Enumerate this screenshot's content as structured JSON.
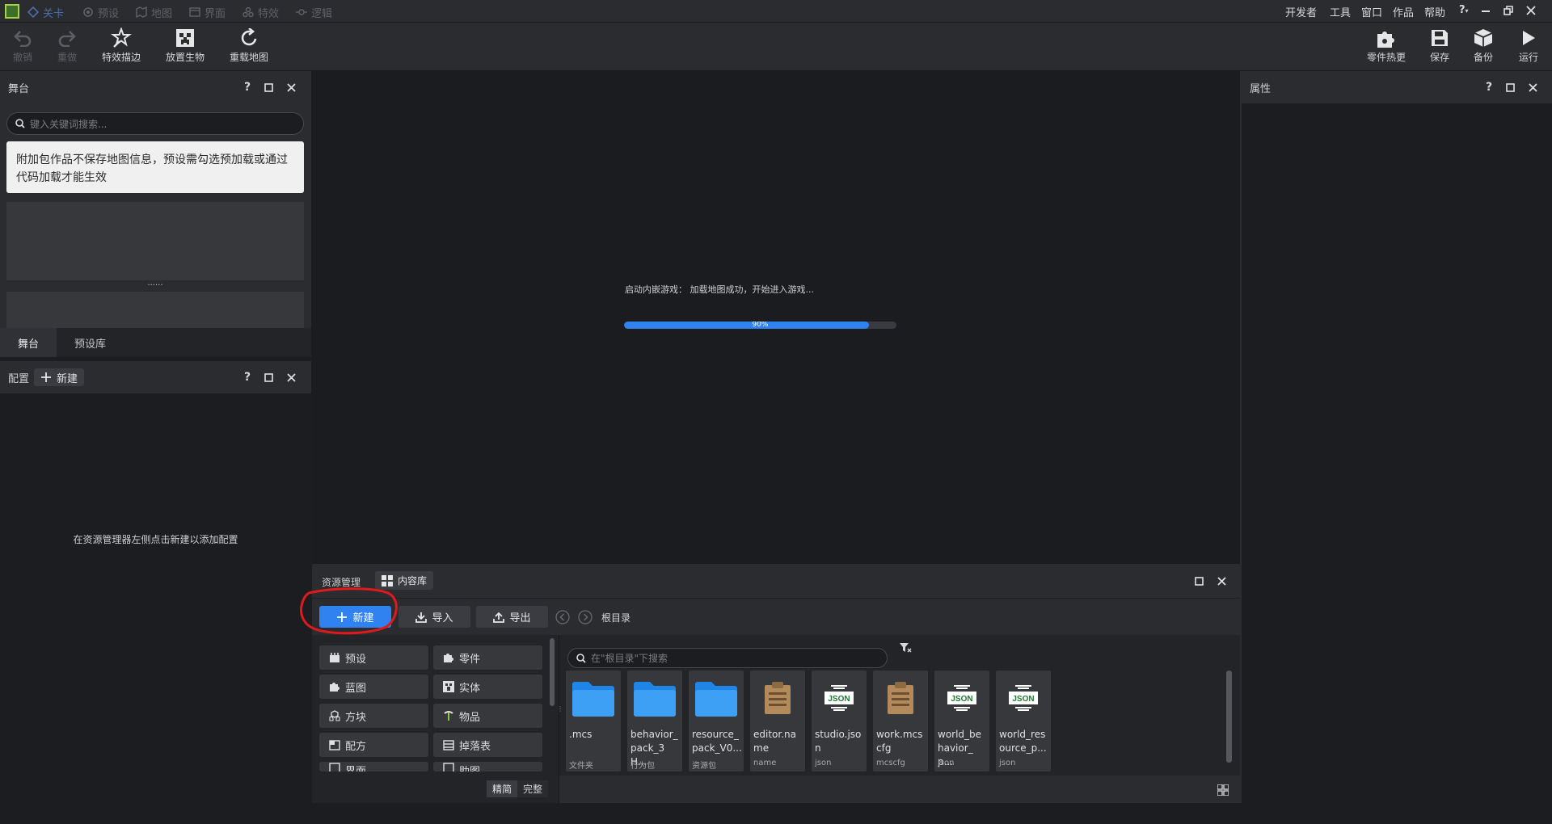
{
  "menubar": {
    "tabs": [
      {
        "label": "关卡"
      },
      {
        "label": "预设"
      },
      {
        "label": "地图"
      },
      {
        "label": "界面"
      },
      {
        "label": "特效"
      },
      {
        "label": "逻辑"
      }
    ],
    "right_menu": [
      "开发者",
      "工具",
      "窗口",
      "作品",
      "帮助",
      "?"
    ]
  },
  "toolbar": {
    "left": [
      {
        "label": "撤销"
      },
      {
        "label": "重做"
      },
      {
        "label": "特效描边"
      },
      {
        "label": "放置生物"
      },
      {
        "label": "重载地图"
      }
    ],
    "right": [
      {
        "label": "零件热更"
      },
      {
        "label": "保存"
      },
      {
        "label": "备份"
      },
      {
        "label": "运行"
      }
    ]
  },
  "stage_panel": {
    "title": "舞台",
    "search_placeholder": "键入关键词搜索...",
    "notice": "附加包作品不保存地图信息，预设需勾选预加载或通过代码加载才能生效",
    "splitter": "......",
    "tabs": [
      {
        "label": "舞台"
      },
      {
        "label": "预设库"
      }
    ]
  },
  "config_panel": {
    "title": "配置",
    "new_label": "新建",
    "empty_text": "在资源管理器左侧点击新建以添加配置"
  },
  "viewport": {
    "loading_text": "启动内嵌游戏：  加载地图成功，开始进入游戏...",
    "progress": {
      "value": 90,
      "label": "90%"
    }
  },
  "properties_panel": {
    "title": "属性"
  },
  "assets_panel": {
    "tabs": [
      {
        "label": "资源管理"
      },
      {
        "label": "内容库"
      }
    ],
    "buttons": {
      "new": "新建",
      "import": "导入",
      "export": "导出"
    },
    "breadcrumb": "根目录",
    "search_placeholder": "在\"根目录\"下搜索",
    "categories": [
      {
        "label": "预设"
      },
      {
        "label": "零件"
      },
      {
        "label": "蓝图"
      },
      {
        "label": "实体"
      },
      {
        "label": "方块"
      },
      {
        "label": "物品"
      },
      {
        "label": "配方"
      },
      {
        "label": "掉落表"
      },
      {
        "label": "界面"
      },
      {
        "label": "助图"
      }
    ],
    "view_modes": [
      "精简",
      "完整"
    ],
    "files": [
      {
        "name": ".mcs",
        "type": "文件夹",
        "icon": "folder"
      },
      {
        "name": "behavior_ pack_3H...",
        "type": "行为包",
        "icon": "folder"
      },
      {
        "name": "resource_ pack_V0...",
        "type": "资源包",
        "icon": "folder"
      },
      {
        "name": "editor.na me",
        "type": "name",
        "icon": "clipboard"
      },
      {
        "name": "studio.jso n",
        "type": "json",
        "icon": "json"
      },
      {
        "name": "work.mcs cfg",
        "type": "mcscfg",
        "icon": "clipboard"
      },
      {
        "name": "world_be havior_p...",
        "type": "json",
        "icon": "json"
      },
      {
        "name": "world_res ource_p...",
        "type": "json",
        "icon": "json"
      }
    ]
  },
  "annotation": {
    "color": "#e0191c"
  },
  "colors": {
    "accent": "#2f82f0",
    "panel": "#2b2c30",
    "background": "#1c1d20"
  }
}
